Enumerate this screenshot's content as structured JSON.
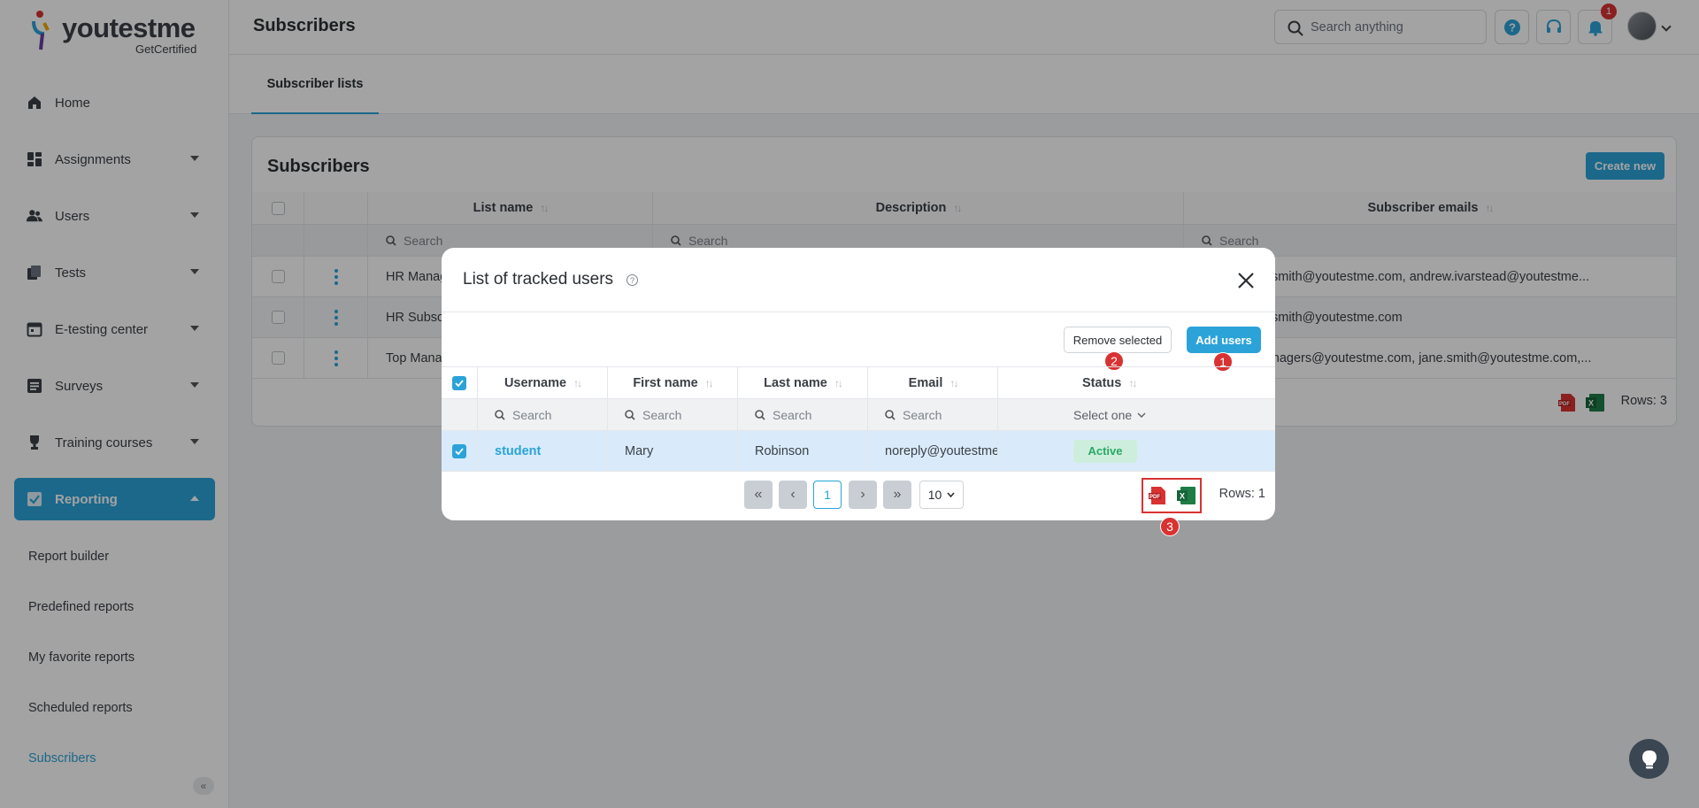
{
  "app": {
    "logo_word": "youtestme",
    "logo_sub": "GetCertified"
  },
  "header": {
    "page_title": "Subscribers",
    "search_placeholder": "Search anything",
    "notification_count": "1"
  },
  "sidebar": {
    "items": [
      {
        "label": "Home",
        "icon": "home-icon"
      },
      {
        "label": "Assignments",
        "icon": "dashboard-icon"
      },
      {
        "label": "Users",
        "icon": "users-icon"
      },
      {
        "label": "Tests",
        "icon": "tests-icon"
      },
      {
        "label": "E-testing center",
        "icon": "calendar-icon"
      },
      {
        "label": "Surveys",
        "icon": "survey-icon"
      },
      {
        "label": "Training courses",
        "icon": "trophy-icon"
      },
      {
        "label": "Reporting",
        "icon": "report-icon"
      }
    ],
    "subitems": [
      "Report builder",
      "Predefined reports",
      "My favorite reports",
      "Scheduled reports",
      "Subscribers"
    ]
  },
  "tabs": {
    "subscriber_lists": "Subscriber lists"
  },
  "card": {
    "title": "Subscribers",
    "create_label": "Create new",
    "columns": [
      "List name",
      "Description",
      "Subscriber emails"
    ],
    "search_placeholder": "Search",
    "rows": [
      {
        "name": "HR Manag",
        "emails": "e.com, jane.smith@youtestme.com, andrew.ivarstead@youtestme..."
      },
      {
        "name": "HR Subsc",
        "emails": "e.com, jane.smith@youtestme.com"
      },
      {
        "name": "Top Mana",
        "emails": "me.com, managers@youtestme.com, jane.smith@youtestme.com,..."
      }
    ],
    "rows_label": "Rows: 3"
  },
  "modal": {
    "title": "List of tracked users",
    "remove_label": "Remove selected",
    "add_label": "Add users",
    "steps": [
      "1",
      "2",
      "3"
    ],
    "columns": [
      "Username",
      "First name",
      "Last name",
      "Email",
      "Status"
    ],
    "search_placeholder": "Search",
    "status_filter": "Select one",
    "row": {
      "username": "student",
      "first_name": "Mary",
      "last_name": "Robinson",
      "email": "noreply@youtestme...",
      "status": "Active"
    },
    "pager": {
      "page": "1",
      "page_size": "10"
    },
    "rows_label": "Rows: 1"
  },
  "colors": {
    "accent": "#2ba3d8",
    "danger": "#d83232",
    "success": "#2aa865"
  }
}
